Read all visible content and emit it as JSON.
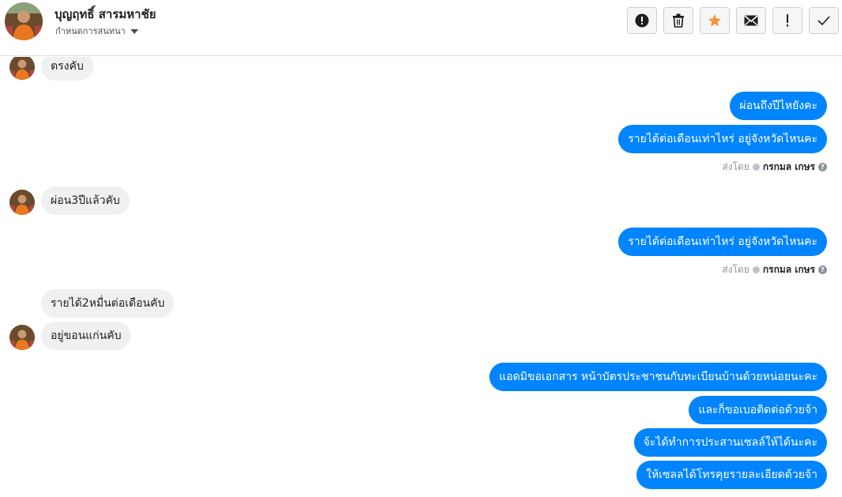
{
  "header": {
    "contact_name": "บุญฤทธิ์ สารมหาชัย",
    "assign_label": "กำหนดการสนทนา"
  },
  "toolbar": {
    "icons": [
      "alert-circle-icon",
      "trash-icon",
      "star-icon",
      "mail-icon",
      "exclamation-icon",
      "check-icon"
    ],
    "star_color": "#f7923b"
  },
  "colors": {
    "outgoing_bubble": "#0084ff",
    "incoming_bubble": "#f1f0f0"
  },
  "messages": {
    "m1": "ตรงคับ",
    "m2": "ผ่อนถึงปีไหยังคะ",
    "m3": "รายได้ต่อเดือนเท่าไหร่ อยู่จังหวัดไหนคะ",
    "m4": "ผ่อน3ปีแล้วคับ",
    "m5": "รายได้ต่อเดือนเท่าไหร่ อยู่จังหวัดไหนคะ",
    "m6": "รายได้2หมื่นต่อเดือนคับ",
    "m7": "อยู่ขอนแก่นคับ",
    "m8": "แอดมิขอเอกสาร หน้าบัตรประชาชนกับทะเบียนบ้านด้วยหน่อยนะคะ",
    "m9": "และก็ขอเบอติดต่อด้วยจ้า",
    "m10": "จ้ะได้ทำการประสานเซลล์ให้ได้นะคะ",
    "m11": "ให้เซลลได้โทรคุยรายละเอียดด้วยจ้า"
  },
  "sent_by": {
    "label": "ส่งโดย",
    "sender": "กรกมล เกษร"
  }
}
